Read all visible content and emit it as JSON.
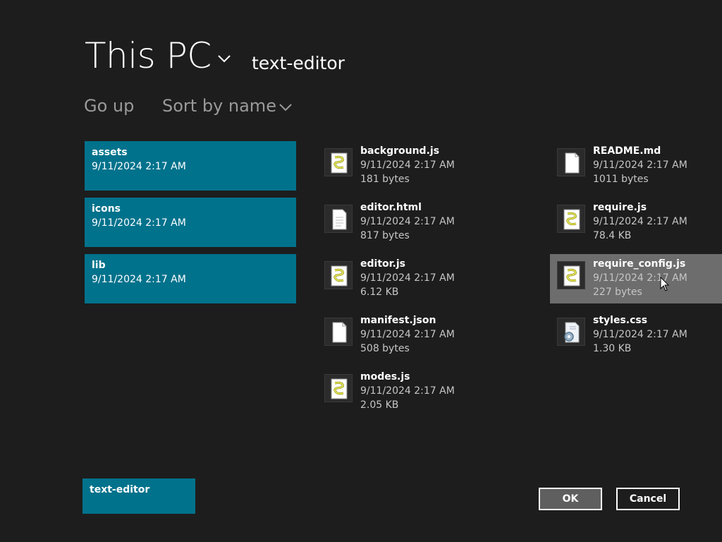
{
  "header": {
    "location": "This PC",
    "folder": "text-editor"
  },
  "commands": {
    "go_up": "Go up",
    "sort": "Sort by name"
  },
  "folders": [
    {
      "name": "assets",
      "date": "9/11/2024 2:17 AM"
    },
    {
      "name": "icons",
      "date": "9/11/2024 2:17 AM"
    },
    {
      "name": "lib",
      "date": "9/11/2024 2:17 AM"
    }
  ],
  "files": [
    {
      "name": "background.js",
      "date": "9/11/2024 2:17 AM",
      "size": "181 bytes",
      "icon": "script-icon"
    },
    {
      "name": "editor.html",
      "date": "9/11/2024 2:17 AM",
      "size": "817 bytes",
      "icon": "html-file-icon"
    },
    {
      "name": "editor.js",
      "date": "9/11/2024 2:17 AM",
      "size": "6.12 KB",
      "icon": "script-icon"
    },
    {
      "name": "manifest.json",
      "date": "9/11/2024 2:17 AM",
      "size": "508 bytes",
      "icon": "blank-file-icon"
    },
    {
      "name": "modes.js",
      "date": "9/11/2024 2:17 AM",
      "size": "2.05 KB",
      "icon": "script-icon"
    },
    {
      "name": "README.md",
      "date": "9/11/2024 2:17 AM",
      "size": "1011 bytes",
      "icon": "blank-file-icon"
    },
    {
      "name": "require.js",
      "date": "9/11/2024 2:17 AM",
      "size": "78.4 KB",
      "icon": "script-icon"
    },
    {
      "name": "require_config.js",
      "date": "9/11/2024 2:17 AM",
      "size": "227 bytes",
      "icon": "script-icon",
      "selected": true
    },
    {
      "name": "styles.css",
      "date": "9/11/2024 2:17 AM",
      "size": "1.30 KB",
      "icon": "css-file-icon"
    }
  ],
  "footer": {
    "folder_name": "text-editor",
    "ok_label": "OK",
    "cancel_label": "Cancel"
  },
  "colors": {
    "background": "#1d1d1d",
    "accent_tile": "#00728c",
    "selected_item": "#6d6d6d",
    "muted_text": "#9a9a9a"
  }
}
